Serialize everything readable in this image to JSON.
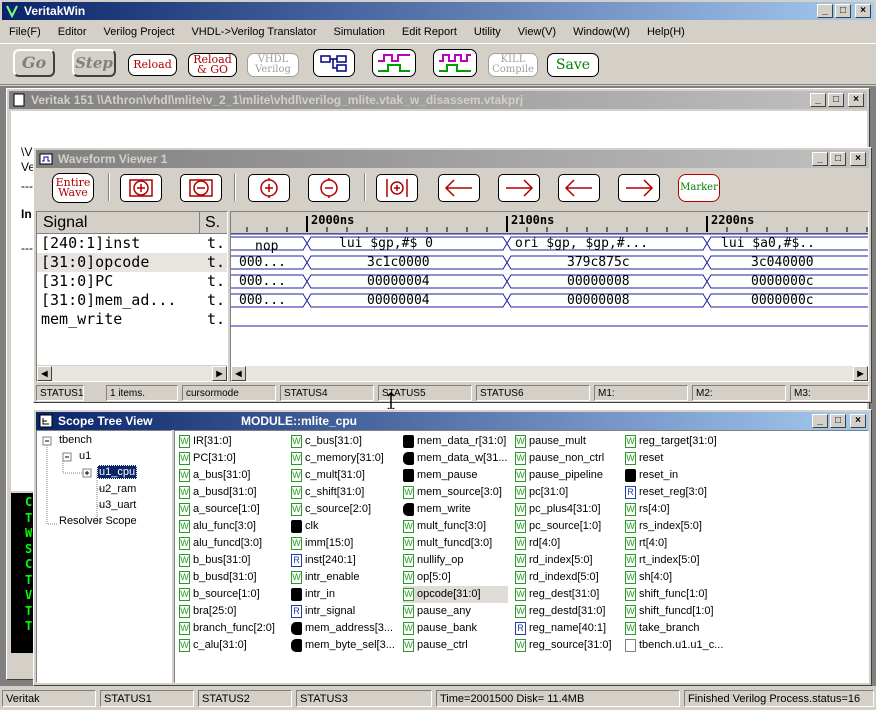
{
  "app": {
    "title": "VeritakWin",
    "menu": [
      "File(F)",
      "Editor",
      "Verilog Project",
      "VHDL->Verilog Translator",
      "Simulation",
      "Edit Report",
      "Utility",
      "View(V)",
      "Window(W)",
      "Help(H)"
    ],
    "toolbar": {
      "go": "Go",
      "step": "Step",
      "reload": "Reload",
      "reload_go_1": "Reload",
      "reload_go_2": "& GO",
      "vhdl_1": "VHDL",
      "vhdl_2": "Verilog",
      "kill_1": "KILL",
      "kill_2": "Compile",
      "save": "Save"
    }
  },
  "project_window": {
    "title": "Veritak 151 \\\\Athron\\vhdl\\mlite\\v_2_1\\mlite\\vhdl\\verilog_mlite.vtak_w_disassem.vtakprj",
    "side_chars": [
      "\\V",
      "Ve",
      "---",
      "In",
      "---"
    ]
  },
  "waveform": {
    "title": "Waveform Viewer 1",
    "buttons": {
      "entire_1": "Entire",
      "entire_2": "Wave",
      "marker": "Marker"
    },
    "headers": {
      "signal": "Signal",
      "s": "S."
    },
    "signals": [
      {
        "name": "[240:1]inst",
        "s": "t."
      },
      {
        "name": "[31:0]opcode",
        "s": "t."
      },
      {
        "name": "[31:0]PC",
        "s": "t."
      },
      {
        "name": "[31:0]mem_ad...",
        "s": "t."
      },
      {
        "name": "mem_write",
        "s": "t."
      }
    ],
    "time_labels": [
      "2000ns",
      "2100ns",
      "2200ns"
    ],
    "rows": [
      [
        "nop",
        "lui  $gp,#$   0",
        "ori  $gp, $gp,#...",
        "lui  $a0,#$.."
      ],
      [
        "000...",
        "3c1c0000",
        "379c875c",
        "3c040000"
      ],
      [
        "000...",
        "00000004",
        "00000008",
        "0000000c"
      ],
      [
        "000...",
        "00000004",
        "00000008",
        "0000000c"
      ]
    ],
    "status": [
      "STATUS1",
      "1 items.",
      "cursormode",
      "STATUS4",
      "STATUS5",
      "STATUS6",
      "M1:",
      "M2:",
      "M3:"
    ]
  },
  "scope": {
    "title": "Scope Tree View",
    "module": "MODULE::mlite_cpu",
    "tree": [
      "tbench",
      "u1",
      "u1_cpu",
      "u2_ram",
      "u3_uart",
      "Resolver Scope"
    ],
    "columns": [
      [
        [
          "w",
          "IR[31:0]"
        ],
        [
          "w",
          "PC[31:0]"
        ],
        [
          "w",
          "a_bus[31:0]"
        ],
        [
          "w",
          "a_busd[31:0]"
        ],
        [
          "w",
          "a_source[1:0]"
        ],
        [
          "w",
          "alu_func[3:0]"
        ],
        [
          "w",
          "alu_funcd[3:0]"
        ],
        [
          "w",
          "b_bus[31:0]"
        ],
        [
          "w",
          "b_busd[31:0]"
        ],
        [
          "w",
          "b_source[1:0]"
        ],
        [
          "w",
          "bra[25:0]"
        ],
        [
          "w",
          "branch_func[2:0]"
        ],
        [
          "w",
          "c_alu[31:0]"
        ]
      ],
      [
        [
          "w",
          "c_bus[31:0]"
        ],
        [
          "w",
          "c_memory[31:0]"
        ],
        [
          "w",
          "c_mult[31:0]"
        ],
        [
          "w",
          "c_shift[31:0]"
        ],
        [
          "w",
          "c_source[2:0]"
        ],
        [
          "i",
          "clk"
        ],
        [
          "w",
          "imm[15:0]"
        ],
        [
          "r",
          "inst[240:1]"
        ],
        [
          "w",
          "intr_enable"
        ],
        [
          "i",
          "intr_in"
        ],
        [
          "r",
          "intr_signal"
        ],
        [
          "o",
          "mem_address[3..."
        ],
        [
          "o",
          "mem_byte_sel[3..."
        ]
      ],
      [
        [
          "i",
          "mem_data_r[31:0]"
        ],
        [
          "o",
          "mem_data_w[31..."
        ],
        [
          "i",
          "mem_pause"
        ],
        [
          "w",
          "mem_source[3:0]"
        ],
        [
          "o",
          "mem_write"
        ],
        [
          "w",
          "mult_func[3:0]"
        ],
        [
          "w",
          "mult_funcd[3:0]"
        ],
        [
          "w",
          "nullify_op"
        ],
        [
          "w",
          "op[5:0]"
        ],
        [
          "w",
          "opcode[31:0]"
        ],
        [
          "w",
          "pause_any"
        ],
        [
          "w",
          "pause_bank"
        ],
        [
          "w",
          "pause_ctrl"
        ]
      ],
      [
        [
          "w",
          "pause_mult"
        ],
        [
          "w",
          "pause_non_ctrl"
        ],
        [
          "w",
          "pause_pipeline"
        ],
        [
          "w",
          "pc[31:0]"
        ],
        [
          "w",
          "pc_plus4[31:0]"
        ],
        [
          "w",
          "pc_source[1:0]"
        ],
        [
          "w",
          "rd[4:0]"
        ],
        [
          "w",
          "rd_index[5:0]"
        ],
        [
          "w",
          "rd_indexd[5:0]"
        ],
        [
          "w",
          "reg_dest[31:0]"
        ],
        [
          "w",
          "reg_destd[31:0]"
        ],
        [
          "r",
          "reg_name[40:1]"
        ],
        [
          "w",
          "reg_source[31:0]"
        ]
      ],
      [
        [
          "w",
          "reg_target[31:0]"
        ],
        [
          "w",
          "reset"
        ],
        [
          "i",
          "reset_in"
        ],
        [
          "r",
          "reset_reg[3:0]"
        ],
        [
          "w",
          "rs[4:0]"
        ],
        [
          "w",
          "rs_index[5:0]"
        ],
        [
          "w",
          "rt[4:0]"
        ],
        [
          "w",
          "rt_index[5:0]"
        ],
        [
          "w",
          "sh[4:0]"
        ],
        [
          "w",
          "shift_func[1:0]"
        ],
        [
          "w",
          "shift_funcd[1:0]"
        ],
        [
          "w",
          "take_branch"
        ],
        [
          "b",
          "tbench.u1.u1_c..."
        ]
      ]
    ]
  },
  "console_chars": [
    "C",
    "T",
    "W",
    "S",
    "C",
    "T",
    "V",
    "T",
    "T"
  ],
  "statusbar": [
    "Veritak",
    "STATUS1",
    "STATUS2",
    "STATUS3",
    "Time=2001500 Disk= 11.4MB",
    "Finished Verilog Process.status=16"
  ],
  "colors": {
    "title_active": "#0a246a",
    "title_inactive": "#808080",
    "wave": "#1f1fa8",
    "console_text": "#00ff00"
  }
}
